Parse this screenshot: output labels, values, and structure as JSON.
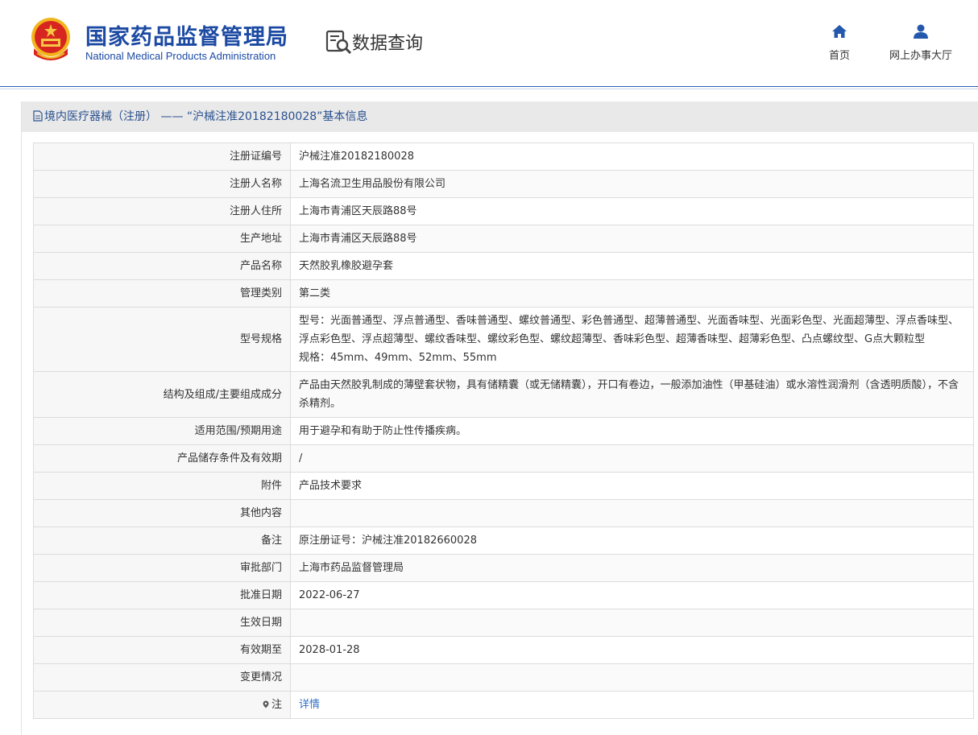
{
  "header": {
    "brand_cn": "国家药品监督管理局",
    "brand_en": "National Medical Products Administration",
    "query_title": "数据查询",
    "nav": [
      {
        "label": "首页",
        "icon": "home-icon"
      },
      {
        "label": "网上办事大厅",
        "icon": "user-icon"
      }
    ]
  },
  "panel": {
    "title": "境内医疗器械（注册） —— “沪械注准20182180028”基本信息"
  },
  "rows": [
    {
      "key": "注册证编号",
      "value": "沪械注准20182180028"
    },
    {
      "key": "注册人名称",
      "value": "上海名流卫生用品股份有限公司"
    },
    {
      "key": "注册人住所",
      "value": "上海市青浦区天辰路88号"
    },
    {
      "key": "生产地址",
      "value": "上海市青浦区天辰路88号"
    },
    {
      "key": "产品名称",
      "value": "天然胶乳橡胶避孕套"
    },
    {
      "key": "管理类别",
      "value": "第二类"
    },
    {
      "key": "型号规格",
      "value_line1": "型号：光面普通型、浮点普通型、香味普通型、螺纹普通型、彩色普通型、超薄普通型、光面香味型、光面彩色型、光面超薄型、浮点香味型、浮点彩色型、浮点超薄型、螺纹香味型、螺纹彩色型、螺纹超薄型、香味彩色型、超薄香味型、超薄彩色型、凸点螺纹型、G点大颗粒型",
      "value_line2": "规格：45mm、49mm、52mm、55mm"
    },
    {
      "key": "结构及组成/主要组成成分",
      "value": "产品由天然胶乳制成的薄壁套状物，具有储精囊（或无储精囊），开口有卷边，一般添加油性（甲基硅油）或水溶性润滑剂（含透明质酸），不含杀精剂。"
    },
    {
      "key": "适用范围/预期用途",
      "value": "用于避孕和有助于防止性传播疾病。"
    },
    {
      "key": "产品储存条件及有效期",
      "value": "/"
    },
    {
      "key": "附件",
      "value": "产品技术要求"
    },
    {
      "key": "其他内容",
      "value": ""
    },
    {
      "key": "备注",
      "value": "原注册证号：沪械注准20182660028"
    },
    {
      "key": "审批部门",
      "value": "上海市药品监督管理局"
    },
    {
      "key": "批准日期",
      "value": "2022-06-27"
    },
    {
      "key": "生效日期",
      "value": ""
    },
    {
      "key": "有效期至",
      "value": "2028-01-28"
    },
    {
      "key": "变更情况",
      "value": ""
    },
    {
      "key": "注",
      "value": "详情"
    }
  ],
  "colors": {
    "brand_blue": "#1c4aa3",
    "link_blue": "#2f6fc6",
    "label_bg": "#f7f7f7",
    "panel_head_bg": "#e9e9e9"
  }
}
